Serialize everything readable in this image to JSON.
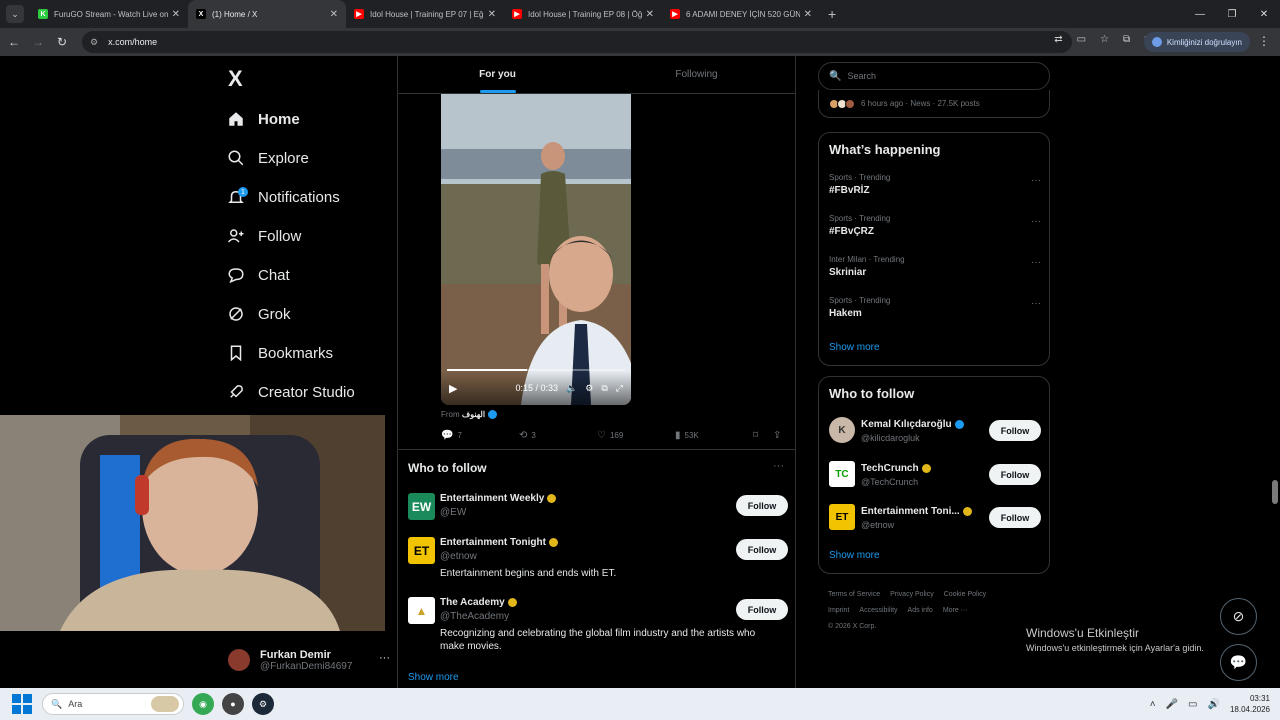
{
  "browser": {
    "tabs": [
      {
        "title": "FuruGO Stream - Watch Live on",
        "fav_color": "#2ecc40",
        "fav_text": "K"
      },
      {
        "title": "(1) Home / X",
        "fav_color": "#000000",
        "fav_text": "X",
        "active": true
      },
      {
        "title": "Idol House | Training EP 07 | Eğ",
        "fav_color": "#ff0000",
        "fav_text": "▶"
      },
      {
        "title": "Idol House | Training EP 08 | Öğ",
        "fav_color": "#ff0000",
        "fav_text": "▶"
      },
      {
        "title": "6 ADAMI DENEY İÇİN 520 GÜN",
        "fav_color": "#ff0000",
        "fav_text": "▶"
      }
    ],
    "url": "x.com/home",
    "profile_label": "Kimliğinizi doğrulayın"
  },
  "sidebar": {
    "logo": "X",
    "items": [
      {
        "label": "Home",
        "icon": "home-icon"
      },
      {
        "label": "Explore",
        "icon": "search-icon"
      },
      {
        "label": "Notifications",
        "icon": "bell-icon",
        "badge": "1"
      },
      {
        "label": "Follow",
        "icon": "person-add-icon"
      },
      {
        "label": "Chat",
        "icon": "chat-icon"
      },
      {
        "label": "Grok",
        "icon": "grok-icon"
      },
      {
        "label": "Bookmarks",
        "icon": "bookmark-icon"
      },
      {
        "label": "Creator Studio",
        "icon": "rocket-icon"
      }
    ],
    "account": {
      "name": "Furkan Demir",
      "handle": "@FurkanDemi84697"
    }
  },
  "timeline": {
    "tabs": [
      "For you",
      "Following"
    ],
    "video": {
      "time": "0:15 / 0:33",
      "progress": 0.45
    },
    "from_label": "From",
    "from_name": "الهنوف",
    "actions": {
      "replies": "7",
      "reposts": "3",
      "likes": "169",
      "views": "53K"
    },
    "who_to_follow": {
      "title": "Who to follow",
      "accounts": [
        {
          "name": "Entertainment Weekly",
          "handle": "@EW",
          "bio": "",
          "logo": "EW",
          "logo_bg": "#1b8a5a",
          "logo_fg": "#ffffff"
        },
        {
          "name": "Entertainment Tonight",
          "handle": "@etnow",
          "bio": "Entertainment begins and ends with ET.",
          "logo": "ET",
          "logo_bg": "#f2c300",
          "logo_fg": "#000000"
        },
        {
          "name": "The Academy",
          "handle": "@TheAcademy",
          "bio": "Recognizing and celebrating the global film industry and the artists who make movies.",
          "logo": "▲",
          "logo_bg": "#ffffff",
          "logo_fg": "#c9a227"
        }
      ],
      "follow_label": "Follow",
      "show_more": "Show more"
    }
  },
  "right": {
    "search_placeholder": "Search",
    "news_strip": "6 hours ago · News · 27.5K posts",
    "happening": {
      "title": "What’s happening",
      "trends": [
        {
          "meta": "Sports · Trending",
          "name": "#FBvRİZ"
        },
        {
          "meta": "Sports · Trending",
          "name": "#FBvÇRZ"
        },
        {
          "meta": "Inter Milan · Trending",
          "name": "Skriniar"
        },
        {
          "meta": "Sports · Trending",
          "name": "Hakem"
        }
      ],
      "show_more": "Show more"
    },
    "who_to_follow": {
      "title": "Who to follow",
      "accounts": [
        {
          "name": "Kemal Kılıçdaroğlu",
          "handle": "@kilicdarogluk",
          "verified": "blue",
          "logo": "K",
          "logo_bg": "#c9b8a8",
          "logo_fg": "#333333"
        },
        {
          "name": "TechCrunch",
          "handle": "@TechCrunch",
          "verified": "gold",
          "logo": "TC",
          "logo_bg": "#ffffff",
          "logo_fg": "#0a9e01"
        },
        {
          "name": "Entertainment Toni...",
          "handle": "@etnow",
          "verified": "gold",
          "logo": "ET",
          "logo_bg": "#f2c300",
          "logo_fg": "#000000"
        }
      ],
      "follow_label": "Follow",
      "show_more": "Show more"
    },
    "footer": [
      "Terms of Service",
      "Privacy Policy",
      "Cookie Policy",
      "Imprint",
      "Accessibility",
      "Ads info",
      "More ···",
      "© 2026 X Corp."
    ]
  },
  "activate_windows": {
    "title": "Windows'u Etkinleştir",
    "subtitle": "Windows'u etkinleştirmek için Ayarlar'a gidin."
  },
  "taskbar": {
    "search_placeholder": "Ara",
    "time": "03:31",
    "date": "18.04.2026"
  }
}
